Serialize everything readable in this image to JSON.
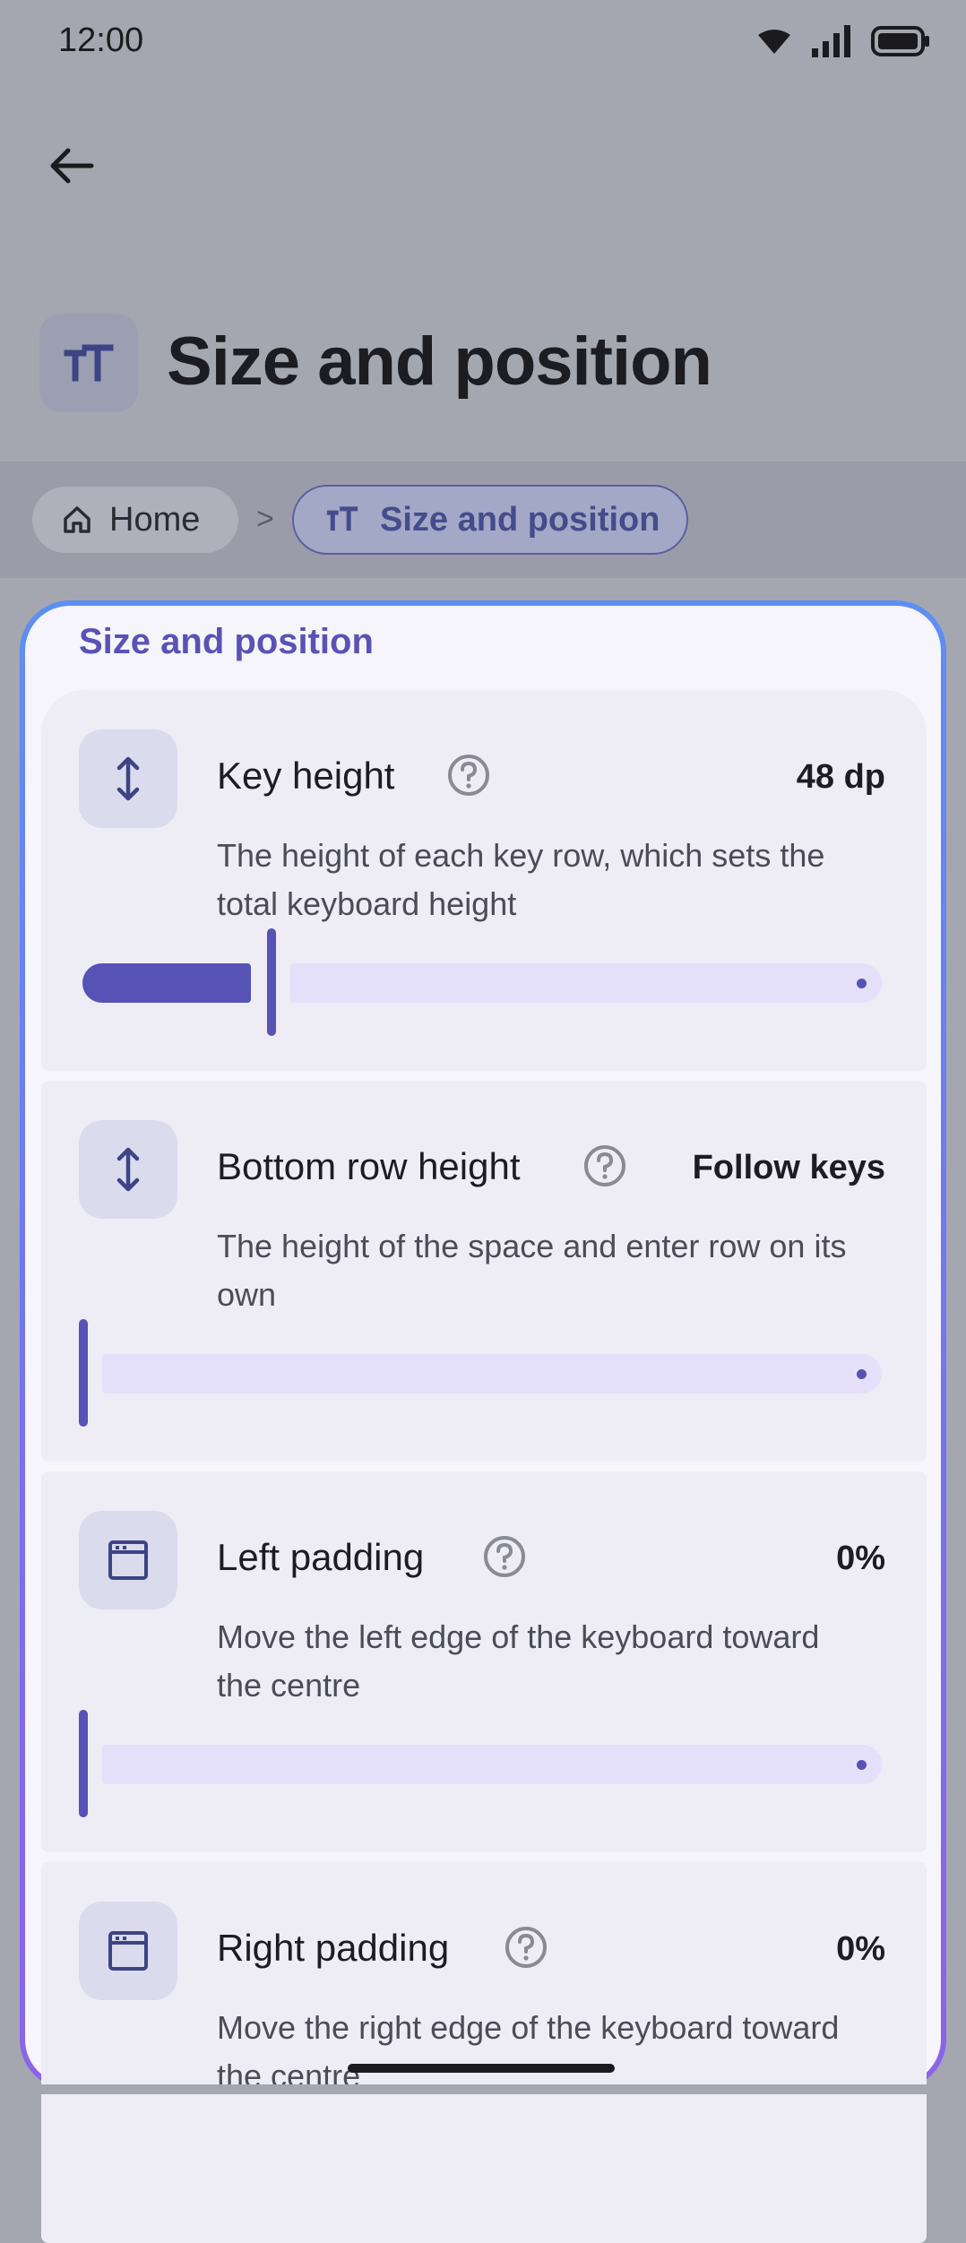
{
  "status_bar": {
    "time": "12:00"
  },
  "header": {
    "title": "Size and position",
    "title_icon": "text-size-icon"
  },
  "breadcrumb": {
    "home_label": "Home",
    "separator": ">",
    "current_label": "Size and position"
  },
  "section": {
    "label": "Size and position",
    "items": [
      {
        "label": "Key height",
        "value": "48 dp",
        "description": "The height of each key row, which sets the total keyboard height",
        "icon": "vertical-resize-icon",
        "slider_fraction": 0.22
      },
      {
        "label": "Bottom row height",
        "value": "Follow keys",
        "description": "The height of the space and enter row on its own",
        "icon": "vertical-resize-icon",
        "slider_fraction": 0
      },
      {
        "label": "Left padding",
        "value": "0%",
        "description": "Move the left edge of the keyboard toward the centre",
        "icon": "window-icon",
        "slider_fraction": 0
      },
      {
        "label": "Right padding",
        "value": "0%",
        "description": "Move the right edge of the keyboard toward the centre",
        "icon": "window-icon",
        "slider_fraction": 0
      }
    ]
  },
  "colors": {
    "accent": "#5652b6",
    "track": "#e4e0fa",
    "scrim": "#a5a7b0"
  }
}
